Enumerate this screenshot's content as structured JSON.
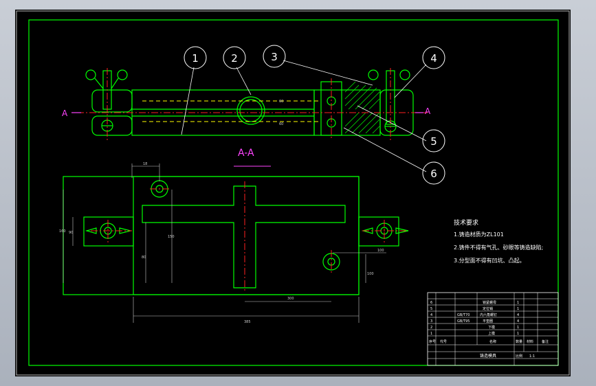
{
  "colors": {
    "background": "#000000",
    "frame": "#00ff00",
    "centerline": "#ff2020",
    "hidden": "#ffff00",
    "section": "#ff44ff",
    "text": "#ffffff",
    "dimension": "#cccccc"
  },
  "callouts": [
    "1",
    "2",
    "3",
    "4",
    "5",
    "6"
  ],
  "section_marks": {
    "left": "A",
    "right": "A",
    "title": "A-A"
  },
  "tech_req": {
    "title": "技术要求",
    "items": [
      "1.铸造材质为ZL101",
      "2.铸件不得有气孔、砂眼等铸造缺陷;",
      "3.分型面不得有凹坑、凸起。"
    ]
  },
  "dims": {
    "top_left": "18",
    "left_h1": "160",
    "left_h2": "90",
    "left_h3": "80",
    "center_h": "150",
    "right_w": "100",
    "right_h": "100",
    "bottom_center": "300",
    "bottom_total": "385",
    "top_right_1": "60",
    "top_right_2": "60"
  },
  "title_block": {
    "rows": [
      [
        "6",
        "",
        "锁紧螺母",
        "1",
        "",
        ""
      ],
      [
        "5",
        "",
        "定位销",
        "1",
        "",
        ""
      ],
      [
        "4",
        "GB/T70",
        "内六角螺钉",
        "4",
        "",
        ""
      ],
      [
        "3",
        "GB/T95",
        "平垫圈",
        "4",
        "",
        ""
      ],
      [
        "2",
        "",
        "下模",
        "1",
        "",
        ""
      ],
      [
        "1",
        "",
        "上模",
        "1",
        "",
        ""
      ]
    ],
    "header": [
      "序号",
      "代号",
      "名称",
      "数量",
      "材料",
      "备注"
    ],
    "drawing_name": "铸造模具",
    "scale_label": "比例",
    "scale": "1:1"
  }
}
